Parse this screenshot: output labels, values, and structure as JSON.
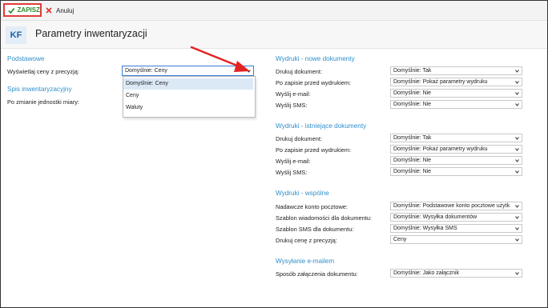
{
  "toolbar": {
    "save_label": "ZAPISZ",
    "cancel_label": "Anuluj"
  },
  "header": {
    "badge": "KF",
    "title": "Parametry inwentaryzacji"
  },
  "left": {
    "section_basic": "Podstawowe",
    "precision_label": "Wyświetlaj ceny z precyzją:",
    "precision_value": "Domyślnie: Ceny",
    "dropdown_options": [
      "Domyślnie: Ceny",
      "Ceny",
      "Waluty"
    ],
    "section_inventory": "Spis inwentaryzacyjny",
    "unit_change_label": "Po zmianie jednostki miary:"
  },
  "right": {
    "new_docs": {
      "title": "Wydruki - nowe dokumenty",
      "rows": [
        {
          "label": "Drukuj dokument:",
          "value": "Domyślnie: Tak"
        },
        {
          "label": "Po zapisie przed wydrukiem:",
          "value": "Domyślnie: Pokaż parametry wydruku"
        },
        {
          "label": "Wyślij e-mail:",
          "value": "Domyślnie: Nie"
        },
        {
          "label": "Wyślij SMS:",
          "value": "Domyślnie: Nie"
        }
      ]
    },
    "existing_docs": {
      "title": "Wydruki - istniejące dokumenty",
      "rows": [
        {
          "label": "Drukuj dokument:",
          "value": "Domyślnie: Tak"
        },
        {
          "label": "Po zapisie przed wydrukiem:",
          "value": "Domyślnie: Pokaż parametry wydruku"
        },
        {
          "label": "Wyślij e-mail:",
          "value": "Domyślnie: Nie"
        },
        {
          "label": "Wyślij SMS:",
          "value": "Domyślnie: Nie"
        }
      ]
    },
    "common": {
      "title": "Wydruki - wspólne",
      "rows": [
        {
          "label": "Nadawcze konto pocztowe:",
          "value": "Domyślnie: Podstawowe konto pocztowe użytk"
        },
        {
          "label": "Szablon wiadomości dla dokumentu:",
          "value": "Domyślnie: Wysyłka dokumentów"
        },
        {
          "label": "Szablon SMS dla dokumentu:",
          "value": "Domyślnie: Wysyłka SMS"
        },
        {
          "label": "Drukuj cenę z precyzją:",
          "value": "Ceny"
        }
      ]
    },
    "email": {
      "title": "Wysyłanie e-mailem",
      "rows": [
        {
          "label": "Sposób załączenia dokumentu:",
          "value": "Domyślnie: Jako załącznik"
        }
      ]
    }
  },
  "colors": {
    "accent": "#2f8fca",
    "save_green": "#2e8b2e",
    "highlight_red": "#e23b3b",
    "badge_bg": "#e3edf7"
  }
}
